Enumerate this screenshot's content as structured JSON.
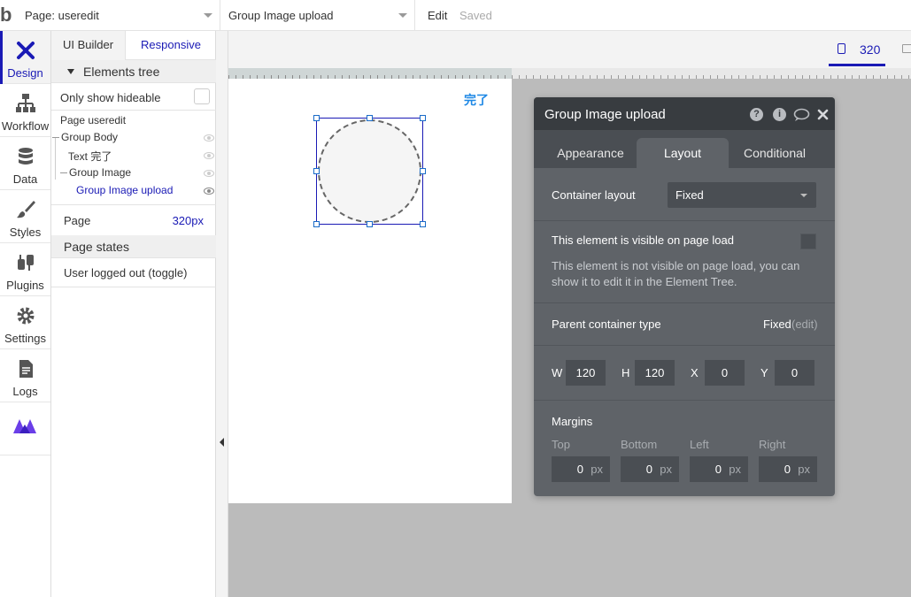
{
  "topbar": {
    "logo": "b",
    "page_select": "Page: useredit",
    "element_select": "Group Image upload",
    "edit_label": "Edit",
    "saved_label": "Saved"
  },
  "iconbar": {
    "items": [
      {
        "label": "Design",
        "icon": "design-icon"
      },
      {
        "label": "Workflow",
        "icon": "workflow-icon"
      },
      {
        "label": "Data",
        "icon": "data-icon"
      },
      {
        "label": "Styles",
        "icon": "brush-icon"
      },
      {
        "label": "Plugins",
        "icon": "plugins-icon"
      },
      {
        "label": "Settings",
        "icon": "gear-icon"
      },
      {
        "label": "Logs",
        "icon": "document-icon"
      },
      {
        "label": "",
        "icon": "logo-icon"
      }
    ],
    "active_color": "#1a1ab5"
  },
  "leftpanel": {
    "tabs": [
      "UI Builder",
      "Responsive"
    ],
    "elements_tree_title": "Elements tree",
    "only_show_hideable": "Only show hideable",
    "tree": [
      {
        "label": "Page useredit"
      },
      {
        "label": "Group Body"
      },
      {
        "label": "Text 完了"
      },
      {
        "label": "Group Image"
      },
      {
        "label": "Group Image upload",
        "selected": true
      }
    ],
    "page_label": "Page",
    "page_value": "320px",
    "page_states_title": "Page states",
    "page_state_item": "User logged out (toggle)"
  },
  "canvas": {
    "device_width": "320",
    "done_text": "完了"
  },
  "property_editor": {
    "title": "Group Image upload",
    "tabs": [
      "Appearance",
      "Layout",
      "Conditional"
    ],
    "active_tab": "Layout",
    "container_layout_label": "Container layout",
    "container_layout_value": "Fixed",
    "visible_label": "This element is visible on page load",
    "visible_help": "This element is not visible on page load, you can show it to edit it in the Element Tree.",
    "parent_type_label": "Parent container type",
    "parent_type_value": "Fixed",
    "parent_type_edit": "(edit)",
    "dims": {
      "w_label": "W",
      "w": "120",
      "h_label": "H",
      "h": "120",
      "x_label": "X",
      "x": "0",
      "y_label": "Y",
      "y": "0"
    },
    "margins_label": "Margins",
    "margins": [
      {
        "label": "Top",
        "value": "0",
        "unit": "px"
      },
      {
        "label": "Bottom",
        "value": "0",
        "unit": "px"
      },
      {
        "label": "Left",
        "value": "0",
        "unit": "px"
      },
      {
        "label": "Right",
        "value": "0",
        "unit": "px"
      }
    ]
  }
}
